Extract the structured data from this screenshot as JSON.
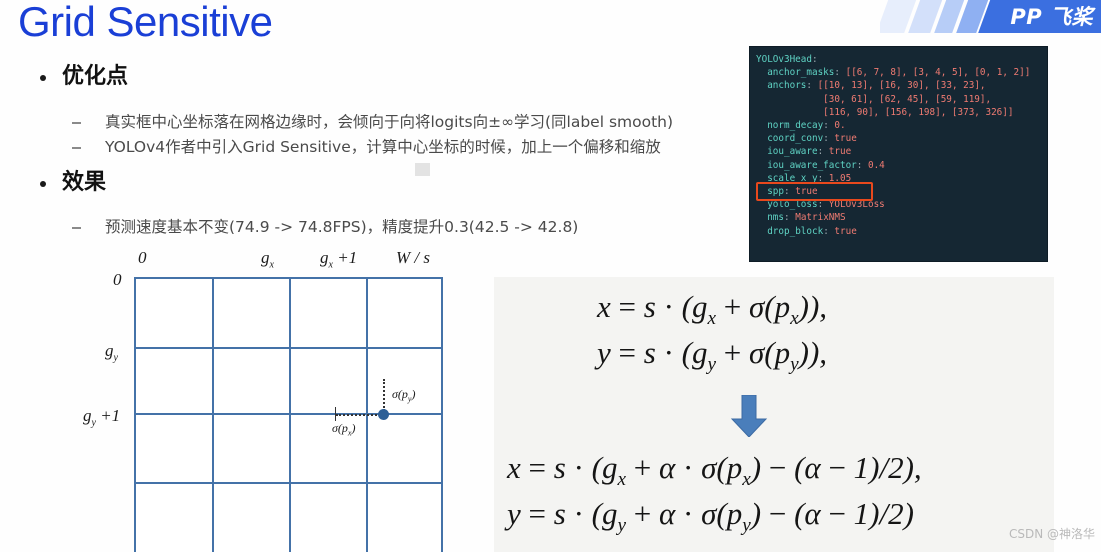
{
  "slide": {
    "title": "Grid Sensitive",
    "title_color": "#1a3fd6",
    "logo_text": "PP 飞桨",
    "watermark": "CSDN @神洛华"
  },
  "sections": [
    {
      "heading": "优化点",
      "items": [
        "真实框中心坐标落在网格边缘时，会倾向于向将logits向±∞学习(同label smooth)",
        "YOLOv4作者中引入Grid Sensitive，计算中心坐标的时候，加上一个偏移和缩放"
      ]
    },
    {
      "heading": "效果",
      "items": [
        "预测速度基本不变(74.9 -> 74.8FPS)，精度提升0.3(42.5 -> 42.8)"
      ]
    }
  ],
  "code_panel": {
    "background": "#152733",
    "key_color": "#5fd3c4",
    "value_color": "#ef7b72",
    "highlight_color": "#e8491d",
    "highlighted_line": "scale_x_y: 1.05",
    "lines": [
      "YOLOv3Head:",
      "  anchor_masks: [[6, 7, 8], [3, 4, 5], [0, 1, 2]]",
      "  anchors: [[10, 13], [16, 30], [33, 23],",
      "            [30, 61], [62, 45], [59, 119],",
      "            [116, 90], [156, 198], [373, 326]]",
      "  norm_decay: 0.",
      "  coord_conv: true",
      "  iou_aware: true",
      "  iou_aware_factor: 0.4",
      "  scale_x_y: 1.05",
      "  spp: true",
      "  yolo_loss: YOLOv3Loss",
      "  nms: MatrixNMS",
      "  drop_block: true"
    ]
  },
  "grid_figure": {
    "line_color": "#4472a8",
    "point_color": "#2e5f96",
    "columns": 4,
    "rows": 4,
    "top_labels": [
      "0",
      "gx",
      "gx + 1",
      "W / s"
    ],
    "left_labels": [
      "0",
      "gy",
      "gy + 1"
    ],
    "annotations": [
      "σ(px)",
      "σ(py)"
    ]
  },
  "formulas": {
    "before": [
      "x = s · (gx + σ(px)),",
      "y = s · (gy + σ(py)),"
    ],
    "after": [
      "x = s · (gx + α · σ(px) − (α − 1)/2),",
      "y = s · (gy + α · σ(py) − (α − 1)/2)"
    ],
    "arrow": "down-arrow",
    "arrow_color": "#4a7ebb",
    "panel_background": "#f4f4f2"
  }
}
